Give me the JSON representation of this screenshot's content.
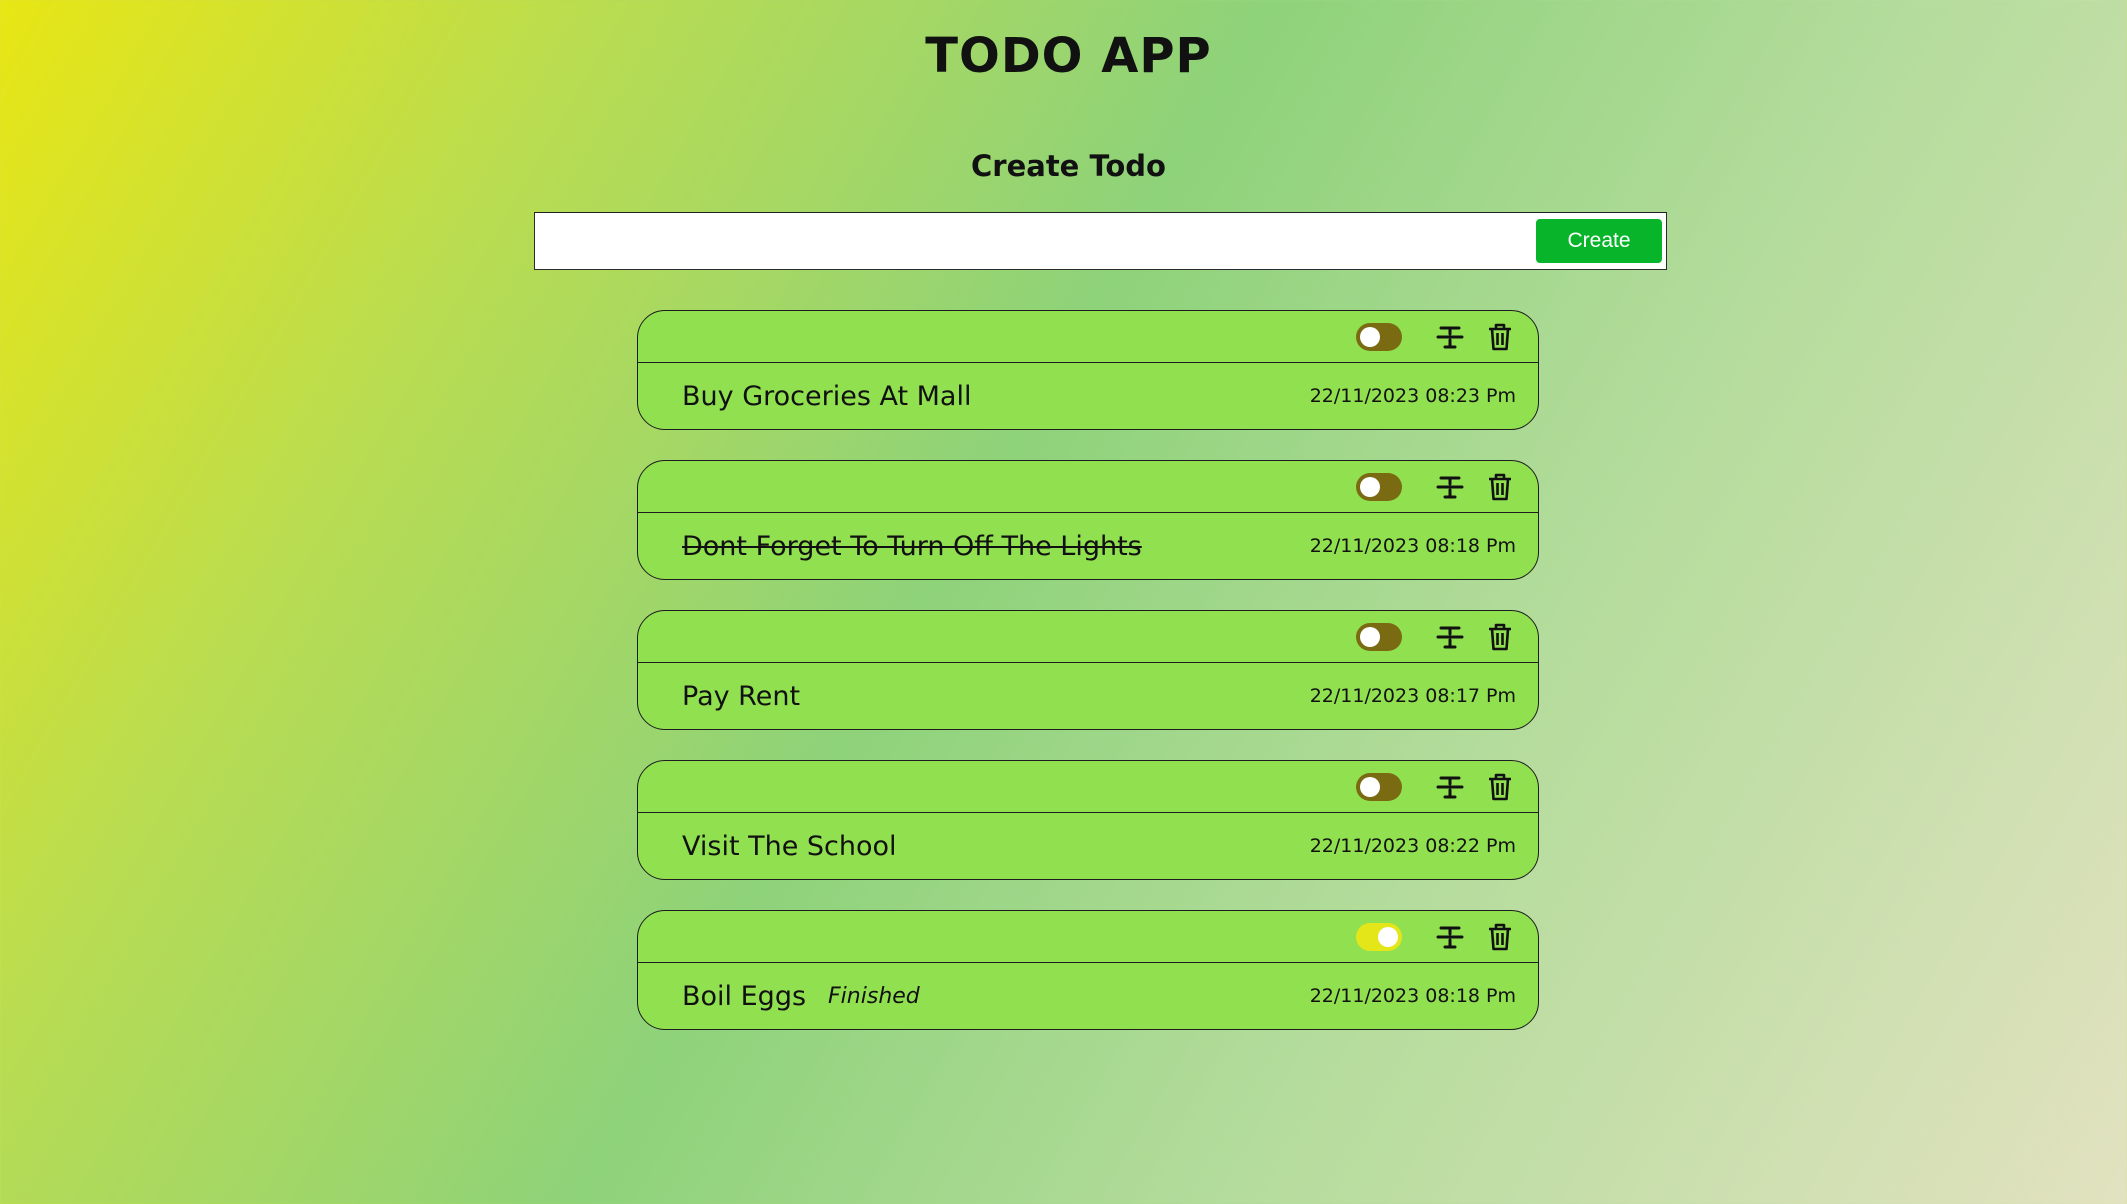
{
  "app": {
    "title": "TODO APP"
  },
  "create": {
    "heading": "Create Todo",
    "input_value": "",
    "button_label": "Create"
  },
  "colors": {
    "card": "#90e050",
    "toggle_off": "#7a6b12",
    "toggle_on": "#e4e61a",
    "create_button": "#08b52a"
  },
  "icons": {
    "toggle": "toggle-switch-icon",
    "strikethrough": "strikethrough-icon",
    "delete": "trash-icon"
  },
  "todos": [
    {
      "text": "Buy Groceries At Mall",
      "date": "22/11/2023 08:23 Pm",
      "struck": false,
      "toggled": false,
      "status": ""
    },
    {
      "text": "Dont Forget To Turn Off The Lights",
      "date": "22/11/2023 08:18 Pm",
      "struck": true,
      "toggled": false,
      "status": ""
    },
    {
      "text": "Pay Rent",
      "date": "22/11/2023 08:17 Pm",
      "struck": false,
      "toggled": false,
      "status": ""
    },
    {
      "text": "Visit The School",
      "date": "22/11/2023 08:22 Pm",
      "struck": false,
      "toggled": false,
      "status": ""
    },
    {
      "text": "Boil Eggs",
      "date": "22/11/2023 08:18 Pm",
      "struck": false,
      "toggled": true,
      "status": "Finished"
    }
  ]
}
